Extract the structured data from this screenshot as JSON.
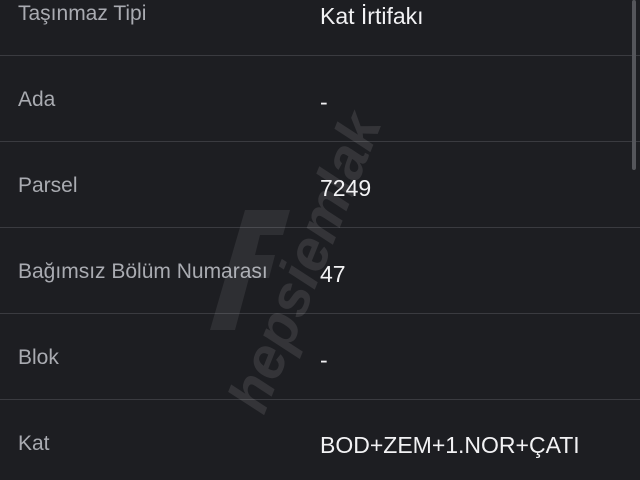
{
  "rows": [
    {
      "label": "Taşınmaz Tipi",
      "value": "Kat İrtifakı"
    },
    {
      "label": "Ada",
      "value": "-"
    },
    {
      "label": "Parsel",
      "value": "7249"
    },
    {
      "label": "Bağımsız Bölüm Numarası",
      "value": "47"
    },
    {
      "label": "Blok",
      "value": "-"
    },
    {
      "label": "Kat",
      "value": "BOD+ZEM+1.NOR+ÇATI"
    }
  ],
  "watermark": {
    "text": "hepsiemlak"
  },
  "colors": {
    "background": "#1d1e22",
    "divider": "#3a3b40",
    "label": "#a9abb1",
    "value": "#f2f2f4"
  }
}
